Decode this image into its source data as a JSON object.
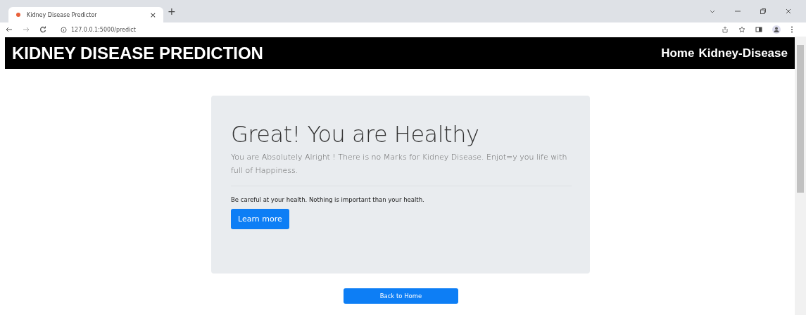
{
  "browser": {
    "tab_title": "Kidney Disease Predictor",
    "tab_close": "×",
    "new_tab": "+",
    "url": "127.0.0.1:5000/predict"
  },
  "navbar": {
    "brand": "KIDNEY DISEASE PREDICTION",
    "links": [
      {
        "label": "Home"
      },
      {
        "label": "Kidney-Disease"
      }
    ]
  },
  "card": {
    "heading": "Great! You are Healthy",
    "lead": "You are Absolutely Alright ! There is no Marks for Kidney Disease. Enjot=y you life with full of Happiness.",
    "note": "Be careful at your health. Nothing is important than your health.",
    "button": "Learn more"
  },
  "back_button": "Back to Home"
}
